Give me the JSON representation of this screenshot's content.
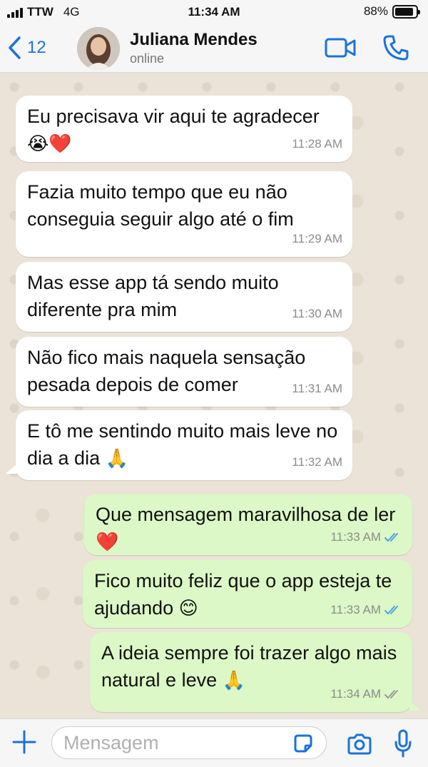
{
  "status_bar": {
    "carrier": "TTW",
    "network": "4G",
    "time": "11:34 AM",
    "battery": "88%",
    "battery_level": 0.88
  },
  "header": {
    "back_count": "12",
    "contact_name": "Juliana Mendes",
    "contact_status": "online"
  },
  "messages": [
    {
      "direction": "in",
      "text": "Eu precisava vir aqui te agradecer",
      "emoji": "😭❤️",
      "time": "11:28 AM"
    },
    {
      "direction": "in",
      "text": "Fazia muito tempo que eu não conseguia seguir algo até o fim",
      "emoji": "",
      "time": "11:29 AM"
    },
    {
      "direction": "in",
      "text": "Mas esse app tá sendo muito diferente pra mim",
      "emoji": "",
      "time": "11:30 AM"
    },
    {
      "direction": "in",
      "text": "Não fico mais naquela sensação pesada depois de comer",
      "emoji": "",
      "time": "11:31 AM"
    },
    {
      "direction": "in",
      "text": "E tô me sentindo muito mais leve no dia a dia",
      "emoji": "🙏",
      "time": "11:32 AM"
    },
    {
      "direction": "out",
      "text": "Que mensagem maravilhosa de ler",
      "emoji": "❤️",
      "time": "11:33 AM",
      "status": "read"
    },
    {
      "direction": "out",
      "text": "Fico muito feliz que o app esteja te ajudando",
      "emoji": "😊",
      "time": "11:33 AM",
      "status": "read"
    },
    {
      "direction": "out",
      "text": "A ideia sempre foi trazer algo mais natural e leve",
      "emoji": "🙏",
      "time": "11:34 AM",
      "status": "delivered"
    }
  ],
  "input": {
    "placeholder": "Mensagem"
  },
  "colors": {
    "accent": "#1a73d9",
    "incoming_bubble": "#ffffff",
    "outgoing_bubble": "#dcf8c6",
    "read_ticks": "#4fa3e0",
    "delivered_ticks": "#9a9a9a",
    "chat_background": "#ebe3d7"
  },
  "icons": {
    "back": "chevron-left-icon",
    "video": "video-camera-icon",
    "call": "phone-icon",
    "plus": "plus-icon",
    "sticker": "sticker-icon",
    "camera": "camera-icon",
    "mic": "microphone-icon",
    "ticks": "double-check-icon"
  }
}
